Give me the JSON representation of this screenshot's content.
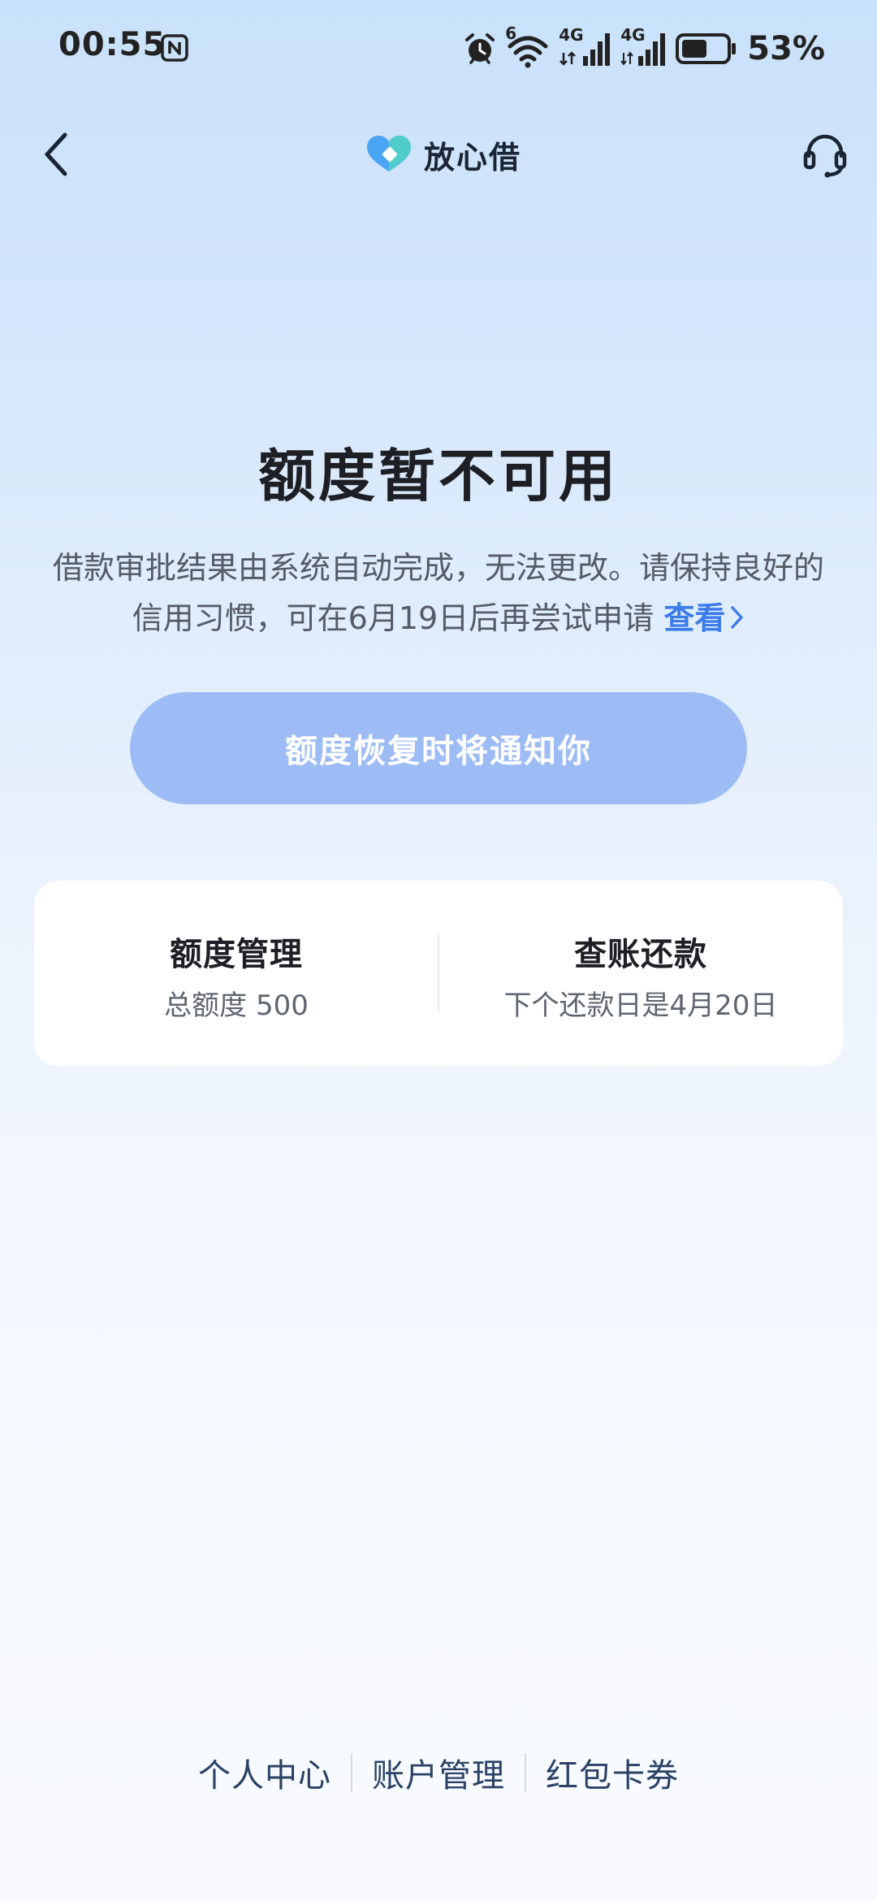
{
  "status_bar": {
    "time": "00:55",
    "battery_percent": "53%",
    "battery_level": 0.53,
    "network_1": "4G",
    "network_2": "4G",
    "wifi_badge": "6"
  },
  "nav": {
    "brand_name": "放心借",
    "brand_colors": [
      "#4aa5f5",
      "#4fd2c7",
      "#3d7ce8"
    ]
  },
  "main": {
    "title": "额度暂不可用",
    "description": "借款审批结果由系统自动完成，无法更改。请保持良好的信用习惯，可在6月19日后再尝试申请",
    "link_label": "查看",
    "notify_button_label": "额度恢复时将通知你"
  },
  "card": {
    "left": {
      "title": "额度管理",
      "subtitle": "总额度 500"
    },
    "right": {
      "title": "查账还款",
      "subtitle": "下个还款日是4月20日"
    }
  },
  "bottom_links": [
    {
      "label": "个人中心"
    },
    {
      "label": "账户管理"
    },
    {
      "label": "红包卡券"
    }
  ],
  "colors": {
    "accent": "#3d7ce8",
    "button_bg": "#9dbcf6",
    "page_bg_top": "#c9e1fa",
    "page_bg_bottom": "#f8fafe"
  }
}
